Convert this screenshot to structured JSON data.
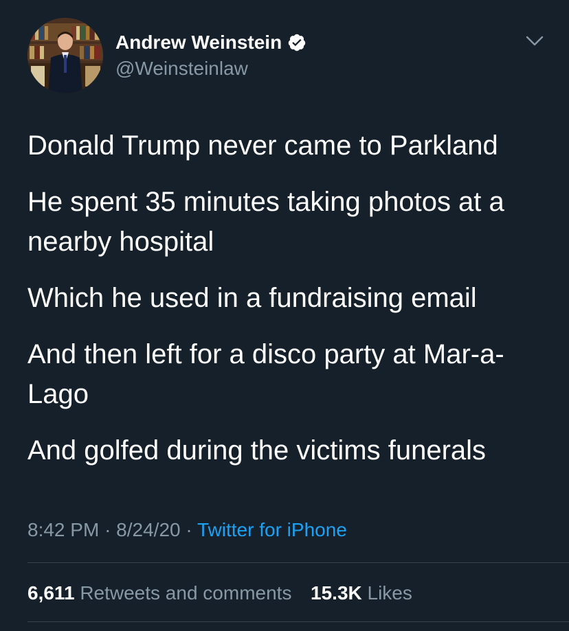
{
  "author": {
    "display_name": "Andrew Weinstein",
    "handle": "@Weinsteinlaw",
    "verified": true,
    "verified_color": "#ffffff"
  },
  "tweet": {
    "paragraphs": [
      "Donald Trump never came to Parkland",
      "He spent 35 minutes taking photos at a nearby hospital",
      "Which he used in a fundraising email",
      "And then left for a disco party at Mar-a-Lago",
      "And golfed during the victims funerals"
    ]
  },
  "meta": {
    "time": "8:42 PM",
    "separator": "·",
    "date": "8/24/20",
    "source": "Twitter for iPhone"
  },
  "stats": {
    "retweets_count": "6,611",
    "retweets_label": "Retweets and comments",
    "likes_count": "15.3K",
    "likes_label": "Likes"
  },
  "colors": {
    "background": "#15202b",
    "text": "#ffffff",
    "secondary": "#8899a6",
    "link": "#1da1f2",
    "divider": "#38444d"
  },
  "icons": {
    "verified": "verified-badge-icon",
    "menu": "chevron-down-icon"
  }
}
